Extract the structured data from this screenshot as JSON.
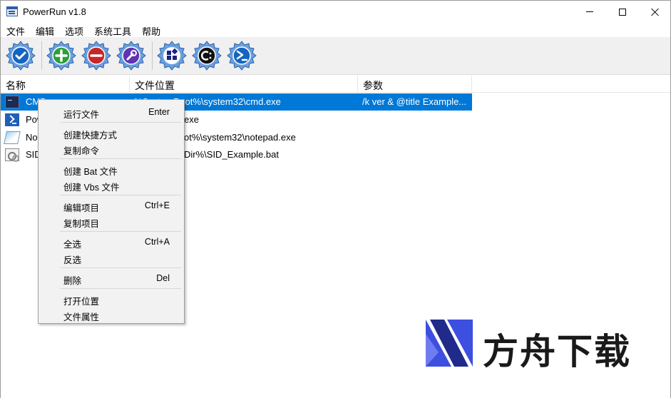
{
  "window": {
    "title": "PowerRun v1.8"
  },
  "menubar": [
    "文件",
    "编辑",
    "选项",
    "系统工具",
    "帮助"
  ],
  "toolbar": {
    "buttons": [
      {
        "name": "run-check",
        "icon": "checkmark-gear-icon",
        "color": "#1565c0"
      },
      {
        "name": "add",
        "icon": "plus-gear-icon",
        "color": "#2e9e3a"
      },
      {
        "name": "remove",
        "icon": "minus-gear-icon",
        "color": "#c62828"
      },
      {
        "name": "edit",
        "icon": "wrench-gear-icon",
        "color": "#5e35b1"
      },
      {
        "name": "system-tools",
        "icon": "apps-gear-icon",
        "color": "#1a237e"
      },
      {
        "name": "cmd",
        "icon": "cmd-gear-icon",
        "color": "#111111"
      },
      {
        "name": "powershell",
        "icon": "powershell-gear-icon",
        "color": "#1565c0"
      }
    ]
  },
  "list": {
    "columns": [
      "名称",
      "文件位置",
      "参数"
    ],
    "rows": [
      {
        "name": "CMD",
        "path": "%SystemRoot%\\system32\\cmd.exe",
        "args": "/k ver & @title Example...",
        "icon": "cmd-icon",
        "selected": true
      },
      {
        "name": "Pow",
        "path": "exe",
        "args": "",
        "icon": "powershell-icon",
        "selected": false
      },
      {
        "name": "Not",
        "path": "ot%\\system32\\notepad.exe",
        "args": "",
        "icon": "notepad-icon",
        "selected": false
      },
      {
        "name": "SID",
        "path": "Dir%\\SID_Example.bat",
        "args": "",
        "icon": "batch-file-icon",
        "selected": false
      }
    ]
  },
  "context_menu": {
    "items": [
      {
        "label": "运行文件",
        "shortcut": "Enter"
      },
      {
        "label": "创建快捷方式",
        "shortcut": ""
      },
      {
        "label": "复制命令",
        "shortcut": ""
      },
      {
        "label": "创建 Bat 文件",
        "shortcut": ""
      },
      {
        "label": "创建 Vbs 文件",
        "shortcut": ""
      },
      {
        "label": "编辑项目",
        "shortcut": "Ctrl+E"
      },
      {
        "label": "复制项目",
        "shortcut": ""
      },
      {
        "label": "全选",
        "shortcut": "Ctrl+A"
      },
      {
        "label": "反选",
        "shortcut": ""
      },
      {
        "label": "删除",
        "shortcut": "Del"
      },
      {
        "label": "打开位置",
        "shortcut": ""
      },
      {
        "label": "文件属性",
        "shortcut": ""
      }
    ]
  },
  "watermark": {
    "text": "方舟下载",
    "accent": "#3d4fe0"
  },
  "colors": {
    "selection": "#0078d7",
    "toolbar_bg": "#f0f0f0",
    "menu_bg": "#f2f2f2"
  }
}
